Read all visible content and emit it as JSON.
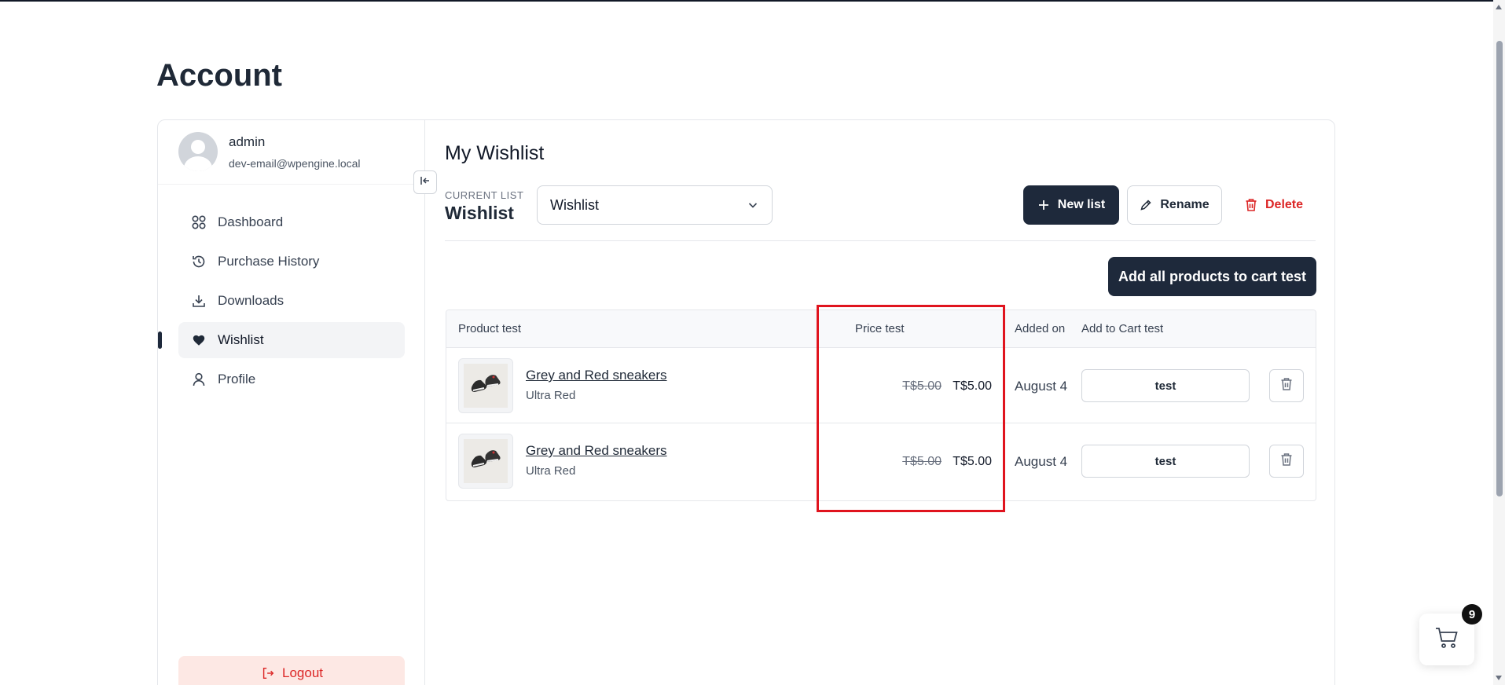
{
  "page": {
    "title": "Account"
  },
  "user": {
    "name": "admin",
    "email": "dev-email@wpengine.local"
  },
  "nav": {
    "items": [
      {
        "label": "Dashboard",
        "icon": "grid-icon",
        "active": false
      },
      {
        "label": "Purchase History",
        "icon": "history-icon",
        "active": false
      },
      {
        "label": "Downloads",
        "icon": "download-icon",
        "active": false
      },
      {
        "label": "Wishlist",
        "icon": "heart-icon",
        "active": true
      },
      {
        "label": "Profile",
        "icon": "user-icon",
        "active": false
      }
    ],
    "logout_label": "Logout"
  },
  "wishlist": {
    "title": "My Wishlist",
    "current_list_label": "CURRENT LIST",
    "current_list_name": "Wishlist",
    "select_value": "Wishlist",
    "new_list_label": "New list",
    "rename_label": "Rename",
    "delete_label": "Delete",
    "add_all_label": "Add all products to cart test"
  },
  "table": {
    "headers": {
      "product": "Product test",
      "price": "Price test",
      "added_on": "Added on",
      "add_to_cart": "Add to Cart test"
    },
    "rows": [
      {
        "name": "Grey and Red sneakers",
        "variant": "Ultra Red",
        "price_old": "T$5.00",
        "price_new": "T$5.00",
        "added_on": "August 4",
        "button_label": "test"
      },
      {
        "name": "Grey and Red sneakers",
        "variant": "Ultra Red",
        "price_old": "T$5.00",
        "price_new": "T$5.00",
        "added_on": "August 4",
        "button_label": "test"
      }
    ]
  },
  "cart": {
    "count": "9"
  },
  "colors": {
    "primary_dark": "#1e293b",
    "danger": "#dc2626",
    "highlight": "#e0141e"
  }
}
